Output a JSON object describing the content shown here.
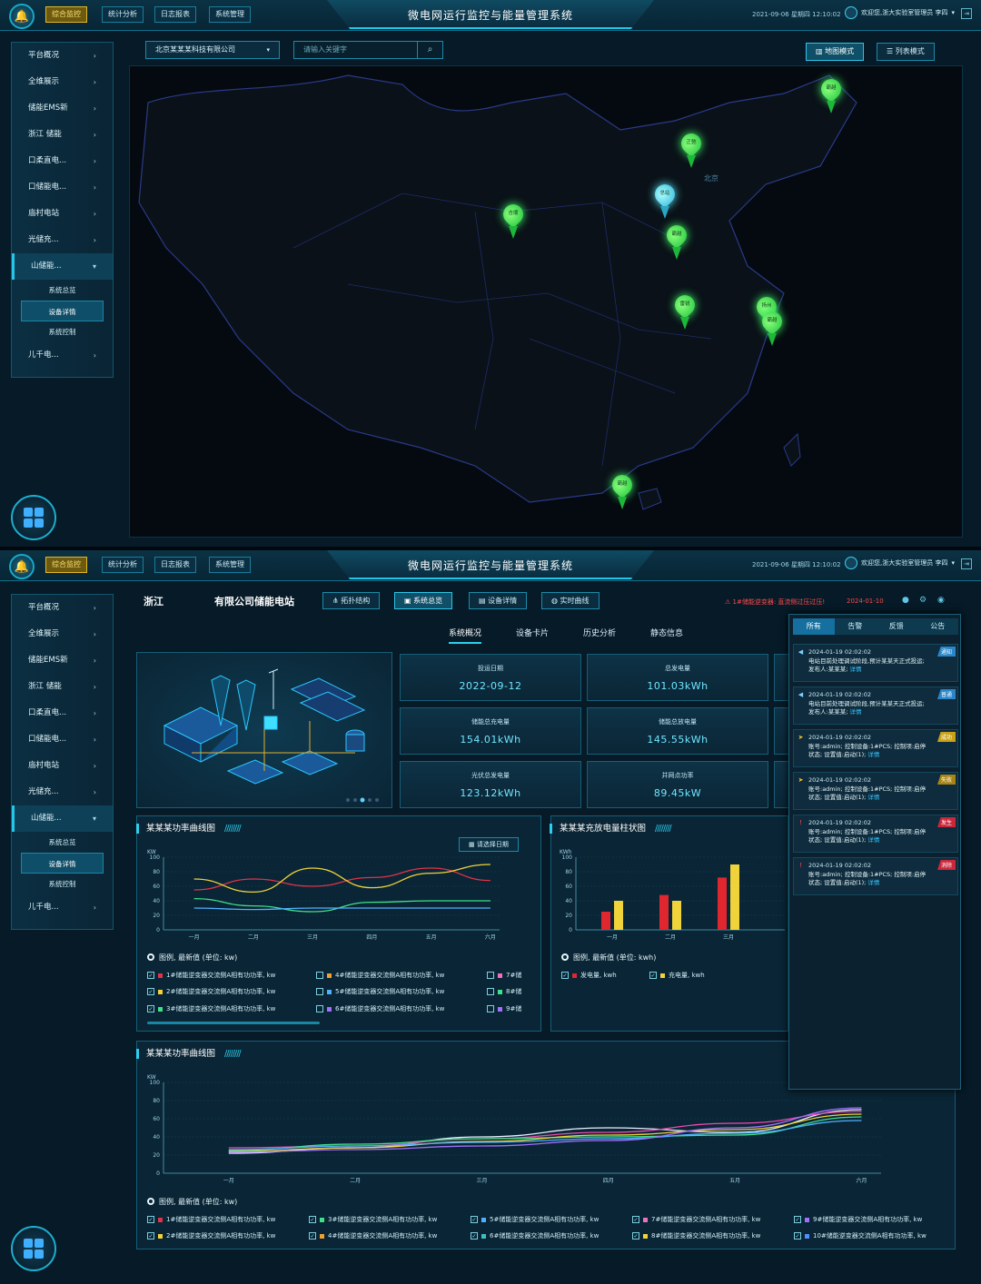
{
  "app": {
    "title": "微电网运行监控与能量管理系统",
    "datetime": "2021-09-06 星期四 12:10:02",
    "user": "欢迎您,浙大实验室管理员 李四",
    "nav": [
      "综合监控",
      "统计分析",
      "日志报表",
      "系统管理"
    ]
  },
  "sidebar": {
    "items": [
      "平台概况",
      "全维展示",
      "储能EMS新",
      "浙江      储能",
      "   口柔直电...",
      "   口储能电...",
      "   庙村电站",
      "   光储充...",
      "   山储能..."
    ],
    "sub": [
      "系统总览",
      "设备详情",
      "系统控制"
    ],
    "last": "   儿千电..."
  },
  "map": {
    "company": "北京某某某科技有限公司",
    "search_placeholder": "请输入关键字",
    "modes": [
      "地图模式",
      "列表模式"
    ],
    "city": "北京",
    "pins": [
      "霸越",
      "正驰",
      "总站",
      "吉顺",
      "霸越",
      "雷锐",
      "扬州",
      "霸越",
      "霸越"
    ]
  },
  "station": {
    "province": "浙江",
    "name": "有限公司储能电站",
    "tabs": [
      "拓扑结构",
      "系统总览",
      "设备详情",
      "实时曲线"
    ],
    "alarm": "1#储能逆变器: 直流侧过压过压!",
    "alarm_date": "2024-01-10",
    "subtabs": [
      "系统概况",
      "设备卡片",
      "历史分析",
      "静态信息"
    ]
  },
  "kpis": [
    {
      "k": "投运日期",
      "v": "2022-09-12"
    },
    {
      "k": "总发电量",
      "v": "101.03kWh"
    },
    {
      "k": "储能总充电量",
      "v": "154.01kWh"
    },
    {
      "k": "储能总放电量",
      "v": "145.55kWh"
    },
    {
      "k": "光伏总发电量",
      "v": "123.12kWh"
    },
    {
      "k": "并网点功率",
      "v": "89.45kW"
    }
  ],
  "chart1": {
    "title": "某某某功率曲线图",
    "date_select": "请选择日期",
    "unit": "KW",
    "legend_head": "图例, 最新值 (单位: kw)",
    "legend": [
      "1#储能逆变器交流侧A相有功功率, kw",
      "2#储能逆变器交流侧A相有功功率, kw",
      "3#储能逆变器交流侧A相有功功率, kw",
      "4#储能逆变器交流侧A相有功功率, kw",
      "5#储能逆变器交流侧A相有功功率, kw",
      "6#储能逆变器交流侧A相有功功率, kw",
      "7#储",
      "8#储",
      "9#储"
    ]
  },
  "chart2": {
    "title": "某某某充放电量柱状图",
    "unit": "KWh",
    "legend_head": "图例, 最新值 (单位: kwh)",
    "legend": [
      "发电量, kwh",
      "充电量, kwh"
    ]
  },
  "chart3": {
    "title": "某某某功率曲线图",
    "unit": "KW",
    "legend_head": "图例, 最新值 (单位: kw)",
    "legend": [
      "1#储能逆变器交流侧A相有功功率, kw",
      "3#储能逆变器交流侧A相有功功率, kw",
      "5#储能逆变器交流侧A相有功功率, kw",
      "7#储能逆变器交流侧A相有功功率, kw",
      "9#储能逆变器交流侧A相有功功率, kw",
      "2#储能逆变器交流侧A相有功功率, kw",
      "4#储能逆变器交流侧A相有功功率, kw",
      "6#储能逆变器交流侧A相有功功率, kw",
      "8#储能逆变器交流侧A相有功功率, kw",
      "10#储能逆变器交流侧A相有功功率, kw"
    ]
  },
  "notifications": {
    "tabs": [
      "所有",
      "告警",
      "反馈",
      "公告"
    ],
    "items": [
      {
        "time": "2024-01-19 02:02:02",
        "text": "电站目前处理调试阶段,预计某某天正式投运;",
        "text2": "发布人:某某某;",
        "link": "详情",
        "tag": "通知",
        "color": "#2a86c8"
      },
      {
        "time": "2024-01-19 02:02:02",
        "text": "电站目前处理调试阶段,预计某某天正式投运;",
        "text2": "发布人:某某某;",
        "link": "详情",
        "tag": "普通",
        "color": "#2a86c8"
      },
      {
        "time": "2024-01-19 02:02:02",
        "text": "账号:admin; 控制设备:1#PCS; 控制项:启停",
        "text2": "状态; 设置值:启动(1);",
        "link": "详情",
        "tag": "成功",
        "color": "#c9a219"
      },
      {
        "time": "2024-01-19 02:02:02",
        "text": "账号:admin; 控制设备:1#PCS; 控制项:启停",
        "text2": "状态; 设置值:启动(1);",
        "link": "详情",
        "tag": "失败",
        "color": "#a88415"
      },
      {
        "time": "2024-01-19 02:02:02",
        "text": "账号:admin; 控制设备:1#PCS; 控制项:启停",
        "text2": "状态; 设置值:启动(1);",
        "link": "详情",
        "tag": "发生",
        "color": "#c8283a"
      },
      {
        "time": "2024-01-19 02:02:02",
        "text": "账号:admin; 控制设备:1#PCS; 控制项:启停",
        "text2": "状态; 设置值:启动(1);",
        "link": "详情",
        "tag": "消除",
        "color": "#c8283a"
      }
    ]
  },
  "chart_data": [
    {
      "type": "line",
      "title": "某某某功率曲线图",
      "ylabel": "KW",
      "ylim": [
        0,
        100
      ],
      "categories": [
        "一月",
        "二月",
        "三月",
        "四月",
        "五月",
        "六月"
      ],
      "series": [
        {
          "color": "#e0334a",
          "values": [
            55,
            70,
            60,
            72,
            85,
            68
          ]
        },
        {
          "color": "#f0d23a",
          "values": [
            70,
            52,
            85,
            58,
            78,
            90
          ]
        },
        {
          "color": "#3fe08a",
          "values": [
            43,
            33,
            25,
            38,
            40,
            40
          ]
        },
        {
          "color": "#4fb0ff",
          "values": [
            30,
            28,
            30,
            30,
            30,
            30
          ]
        }
      ]
    },
    {
      "type": "bar",
      "title": "某某某充放电量柱状图",
      "ylabel": "KWh",
      "ylim": [
        0,
        100
      ],
      "categories": [
        "一月",
        "二月",
        "三月"
      ],
      "series": [
        {
          "name": "发电量, kwh",
          "color": "#e0262f",
          "values": [
            25,
            48,
            72
          ]
        },
        {
          "name": "充电量, kwh",
          "color": "#f0d23a",
          "values": [
            40,
            40,
            90
          ]
        }
      ]
    },
    {
      "type": "line",
      "title": "某某某功率曲线图",
      "ylabel": "KW",
      "ylim": [
        0,
        100
      ],
      "categories": [
        "一月",
        "二月",
        "三月",
        "四月",
        "五月",
        "六月"
      ],
      "series": [
        {
          "color": "#e7f0ff",
          "values": [
            22,
            28,
            40,
            50,
            45,
            70
          ]
        },
        {
          "color": "#f04ab0",
          "values": [
            28,
            30,
            38,
            45,
            55,
            68
          ]
        },
        {
          "color": "#3fe08a",
          "values": [
            25,
            32,
            38,
            40,
            42,
            62
          ]
        },
        {
          "color": "#f0d23a",
          "values": [
            24,
            28,
            35,
            42,
            48,
            65
          ]
        },
        {
          "color": "#4fb0ff",
          "values": [
            26,
            30,
            34,
            38,
            44,
            58
          ]
        },
        {
          "color": "#a070ff",
          "values": [
            23,
            26,
            30,
            36,
            50,
            72
          ]
        }
      ]
    }
  ]
}
